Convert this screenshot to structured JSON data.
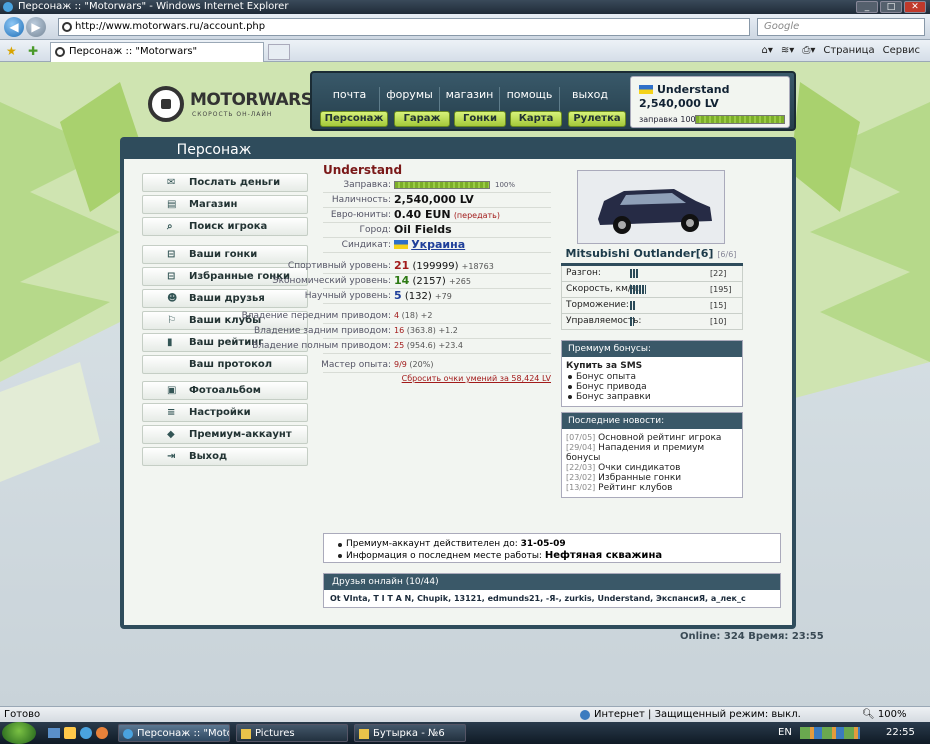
{
  "window": {
    "title": "Персонаж :: \"Motorwars\" - Windows Internet Explorer"
  },
  "browser": {
    "url": "http://www.motorwars.ru/account.php",
    "search_placeholder": "Google",
    "tab_title": "Персонаж :: \"Motorwars\"",
    "tools": {
      "page": "Страница",
      "service": "Сервис"
    }
  },
  "site": {
    "logo_name": "MOTORWARS.RU",
    "logo_slogan": "СКОРОСТЬ ОН-ЛАЙН",
    "topnav": [
      "почта",
      "форумы",
      "магазин",
      "помощь",
      "выход"
    ],
    "subnav": [
      "Персонаж",
      "Гараж",
      "Гонки",
      "Карта",
      "Рулетка"
    ],
    "user": {
      "name": "Understand",
      "money": "2,540,000 LV",
      "fuel_label": "заправка 100%",
      "fuel_pct": 100
    }
  },
  "section_title": "Персонаж",
  "sidebar": [
    {
      "label": "Послать деньги",
      "icon": "money-icon"
    },
    {
      "label": "Магазин",
      "icon": "shop-icon"
    },
    {
      "label": "Поиск игрока",
      "icon": "search-icon"
    },
    {
      "label": "Ваши гонки",
      "icon": "car-icon"
    },
    {
      "label": "Избранные гонки",
      "icon": "car-icon"
    },
    {
      "label": "Ваши друзья",
      "icon": "friends-icon"
    },
    {
      "label": "Ваши клубы",
      "icon": "club-icon"
    },
    {
      "label": "Ваш рейтинг",
      "icon": "rating-icon"
    },
    {
      "label": "Ваш протокол",
      "icon": ""
    },
    {
      "label": "Фотоальбом",
      "icon": "photo-icon"
    },
    {
      "label": "Настройки",
      "icon": "settings-icon"
    },
    {
      "label": "Премиум-аккаунт",
      "icon": "premium-icon"
    },
    {
      "label": "Выход",
      "icon": "exit-icon"
    }
  ],
  "profile": {
    "name": "Understand",
    "fuel_label": "Заправка:",
    "fuel_pct_text": "100%",
    "fuel_pct": 100,
    "cash_label": "Наличность:",
    "cash": "2,540,000 LV",
    "euro_label": "Евро-юниты:",
    "euro": "0.40 EUN",
    "euro_link": "(передать)",
    "city_label": "Город:",
    "city": "Oil Fields",
    "syndicate_label": "Синдикат:",
    "syndicate": "Украина",
    "sport_label": "Спортивный уровень:",
    "sport_level": "21",
    "sport_exp": "(199999)",
    "sport_delta": "+18763",
    "econ_label": "Экономический уровень:",
    "econ_level": "14",
    "econ_exp": "(2157)",
    "econ_delta": "+265",
    "sci_label": "Научный уровень:",
    "sci_level": "5",
    "sci_exp": "(132)",
    "sci_delta": "+79",
    "fwd_label": "Владение передним приводом:",
    "fwd": "4",
    "fwd_exp": "(18)",
    "fwd_delta": "+2",
    "rwd_label": "Владение задним приводом:",
    "rwd": "16",
    "rwd_exp": "(363.8)",
    "rwd_delta": "+1.2",
    "awd_label": "Владение полным приводом:",
    "awd": "25",
    "awd_exp": "(954.6)",
    "awd_delta": "+23.4",
    "master_label": "Мастер опыта:",
    "master": "9/9",
    "master_pct": "(20%)",
    "reset_link": "Сбросить очки умений за 58,424 LV"
  },
  "car": {
    "name": "Mitsubishi Outlander[6]",
    "slots": "[6/6]",
    "stats": [
      {
        "label": "Разгон:",
        "value": "[22]",
        "level": 22
      },
      {
        "label": "Скорость, км/ч:",
        "value": "[195]",
        "level": 39
      },
      {
        "label": "Торможение:",
        "value": "[15]",
        "level": 15
      },
      {
        "label": "Управляемость:",
        "value": "[10]",
        "level": 10
      }
    ]
  },
  "premium": {
    "title": "Премиум бонусы:",
    "buy": "Купить за SMS",
    "items": [
      "Бонус опыта",
      "Бонус привода",
      "Бонус заправки"
    ]
  },
  "news": {
    "title": "Последние новости:",
    "items": [
      {
        "date": "[07/05]",
        "text": "Основной рейтинг игрока"
      },
      {
        "date": "[29/04]",
        "text": "Нападения и премиум бонусы"
      },
      {
        "date": "[22/03]",
        "text": "Очки синдикатов"
      },
      {
        "date": "[23/02]",
        "text": "Избранные гонки"
      },
      {
        "date": "[13/02]",
        "text": "Рейтинг клубов"
      }
    ]
  },
  "info": {
    "premium_label": "Премиум-аккаунт действителен до:",
    "premium_date": "31-05-09",
    "work_label": "Информация о последнем месте работы:",
    "work_place": "Нефтяная скважина"
  },
  "friends": {
    "title": "Друзья онлайн (10/44)",
    "list": "Ot VInta,  T I T A N,  Chupik,  13121,  edmunds21,  -Я-,  zurkis,  Understand,  ЭкспансиЯ,  a_лек_c"
  },
  "footer": {
    "online": "Online: 324  Время: 23:55"
  },
  "statusbar": {
    "left": "Готово",
    "zone": "Интернет | Защищенный режим: выкл.",
    "zoom": "100%"
  },
  "taskbar": {
    "buttons": [
      "Персонаж :: \"Motor...",
      "Pictures",
      "Бутырка - №6"
    ],
    "lang": "EN",
    "clock": "22:55"
  },
  "colors": {
    "panel": "#2f4c5c",
    "accent_green": "#a4c93a",
    "name_red": "#7a1818"
  }
}
